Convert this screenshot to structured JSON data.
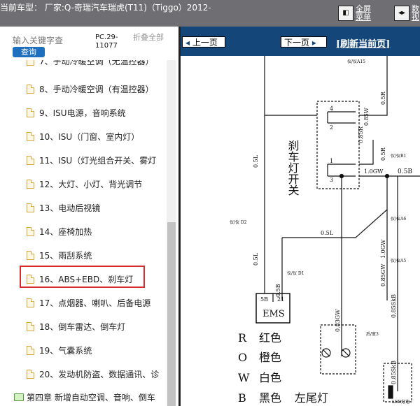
{
  "header": {
    "title": "当前车型： 厂家:Q-奇瑞汽车瑞虎(T11)（Tiggo）2012-",
    "btn_fullscreen": "全屏\n菜单",
    "btn_sync": "数\n视"
  },
  "search": {
    "placeholder": "输入关键字查",
    "button": "查询",
    "pc_label": "PC.29-11077",
    "fold_label": "折叠全部"
  },
  "tree": {
    "items": [
      "7、手动冷暖空调（无温控器）",
      "8、手动冷暖空调（有温控器）",
      "9、ISU电源，音响系统",
      "10、ISU（门窗、室内灯）",
      "11、ISU（灯光组合开关、雾灯",
      "12、大灯、小灯、背光调节",
      "13、电动后视镜",
      "14、座椅加热",
      "15、雨刮系统",
      "16、ABS+EBD、刹车灯",
      "17、点烟器、喇叭、后备电源",
      "18、倒车雷达、倒车灯",
      "19、气囊系统",
      "20、发动机防盗、数据通讯、诊"
    ],
    "chapter": "第四章 新增自动空调、音响、倒车"
  },
  "nav": {
    "prev": "上一页",
    "next": "下一页",
    "refresh": "[刷新当前页]"
  },
  "diagram": {
    "switch_label": "刹车灯开关",
    "ems_label": "EMS",
    "pins": {
      "p4": "4",
      "p2": "2",
      "p1": "1",
      "p3": "3",
      "p5b": "5B",
      "p21": "21"
    },
    "wires": {
      "w_05l_top": "0.5L",
      "w_05l_mid": "0.5L",
      "w_05r_top": "0.5R",
      "w_085r": "0.85R",
      "w_085w": "0.85W",
      "w_05r_mid": "0.5R",
      "w_10gw": "1.0GW",
      "w_05b_top": "0.5B",
      "w_05l_horiz": "0.5L",
      "w_10gw_v": "1.0GW",
      "w_085gw": "0.85GW",
      "w_05b": "0.5B",
      "w_083gw": "0.83GW",
      "w_085skb": "0.85SkB",
      "w_085skb2": "0.85SkB"
    },
    "tags": {
      "t_top": "仪/仪A15",
      "t_right1": "仪/仪B1",
      "t_d2": "仪/仪 D2",
      "t_d1": "仪/仪 D1",
      "t_a5": "仪/仪A5",
      "t_b3": "后/室3",
      "t_a6": "仪/仪A6"
    },
    "legend": [
      {
        "code": "R",
        "name": "红色"
      },
      {
        "code": "O",
        "name": "橙色"
      },
      {
        "code": "W",
        "name": "白色"
      },
      {
        "code": "B",
        "name": "黑色"
      }
    ],
    "tail_lamp": "左尾灯",
    "bulb_label": "LED灯泡"
  }
}
